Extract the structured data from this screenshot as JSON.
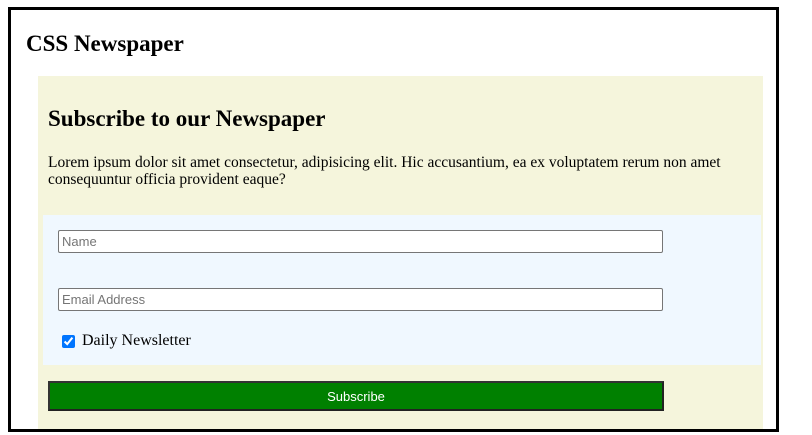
{
  "page": {
    "title": "CSS Newspaper"
  },
  "subscribe": {
    "heading": "Subscribe to our Newspaper",
    "description": "Lorem ipsum dolor sit amet consectetur, adipisicing elit. Hic accusantium, ea ex voluptatem rerum non amet consequuntur officia provident eaque?",
    "name_placeholder": "Name",
    "email_placeholder": "Email Address",
    "newsletter_label": "Daily Newsletter",
    "newsletter_checked": true,
    "button_label": "Subscribe"
  },
  "colors": {
    "panel_background": "#f5f5dc",
    "form_background": "#f0f8ff",
    "button_background": "#008000",
    "button_text": "#ffffff"
  }
}
